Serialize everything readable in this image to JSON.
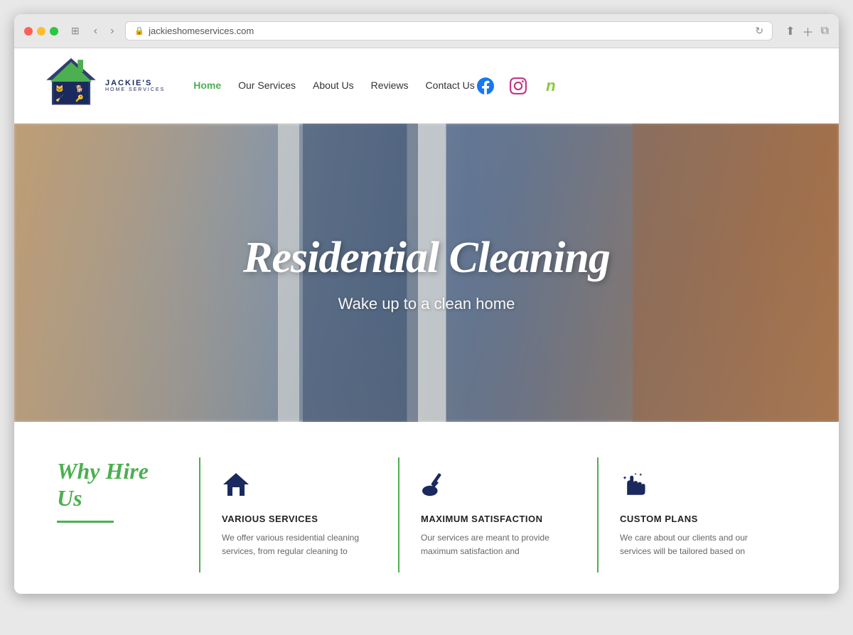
{
  "browser": {
    "url": "jackieshomeservices.com",
    "dots": [
      "red",
      "yellow",
      "green"
    ]
  },
  "header": {
    "logo_text_line1": "JACKIE'S",
    "logo_text_line2": "HOME SERVICES",
    "nav": [
      {
        "label": "Home",
        "active": true
      },
      {
        "label": "Our Services",
        "active": false
      },
      {
        "label": "About Us",
        "active": false
      },
      {
        "label": "Reviews",
        "active": false
      },
      {
        "label": "Contact Us",
        "active": false
      }
    ],
    "social": [
      {
        "name": "Facebook",
        "symbol": "f"
      },
      {
        "name": "Instagram",
        "symbol": "📷"
      },
      {
        "name": "Nextdoor",
        "symbol": "n"
      }
    ]
  },
  "hero": {
    "title": "Residential Cleaning",
    "subtitle": "Wake up to a clean home"
  },
  "why_section": {
    "heading": "Why Hire Us",
    "cards": [
      {
        "icon": "🏠",
        "title": "VARIOUS SERVICES",
        "description": "We offer various residential cleaning services, from regular cleaning to"
      },
      {
        "icon": "🧹",
        "title": "MAXIMUM SATISFACTION",
        "description": "Our services are meant to provide maximum satisfaction and"
      },
      {
        "icon": "✋",
        "title": "CUSTOM PLANS",
        "description": "We care about our clients and our services will be tailored based on"
      }
    ]
  }
}
